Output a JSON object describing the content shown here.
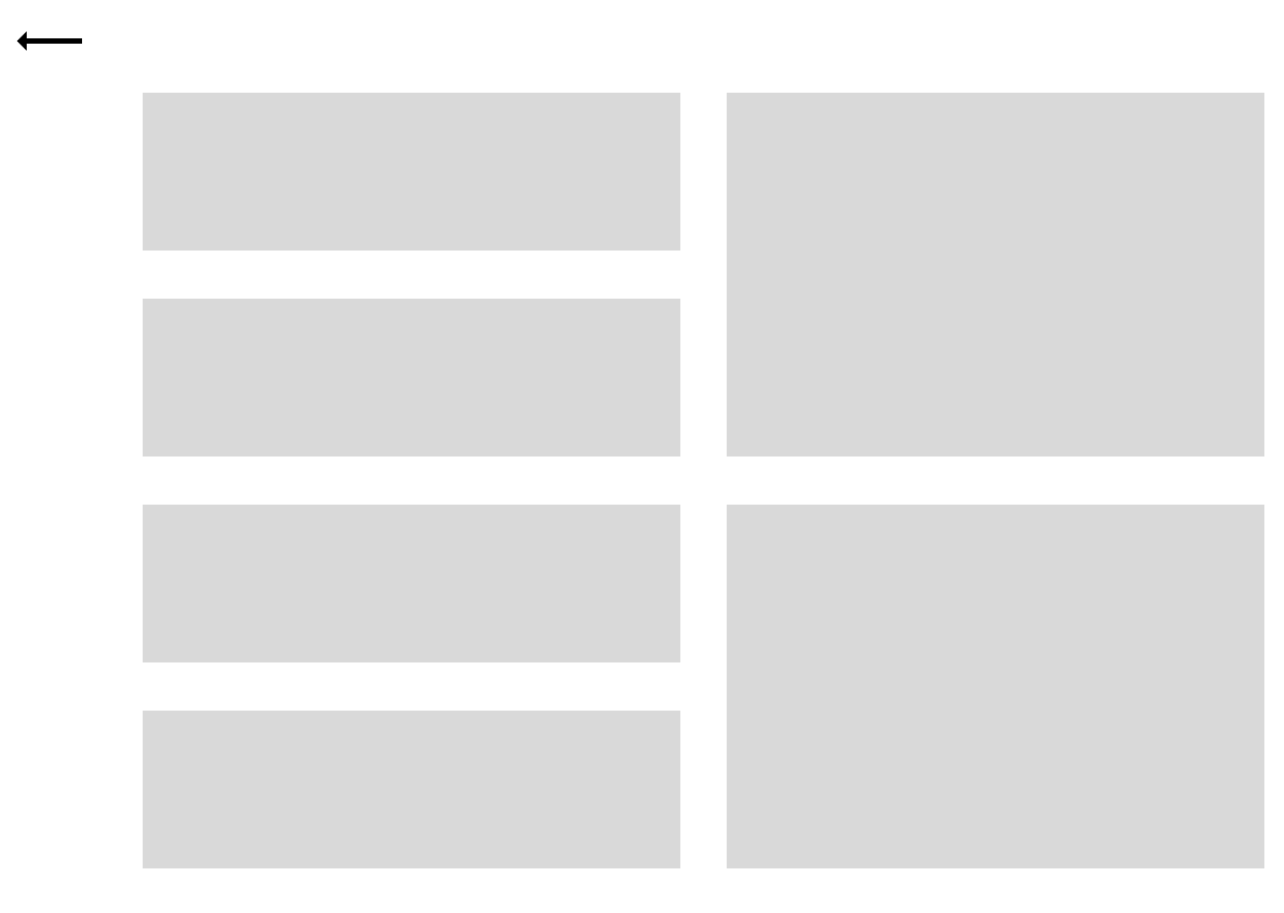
{
  "header": {
    "back_icon": "arrow-left-icon"
  },
  "colors": {
    "background": "#ffffff",
    "placeholder": "#d9d9d9",
    "icon": "#000000"
  },
  "grid": {
    "left_column_tiles": 4,
    "right_column_tiles": 2
  }
}
